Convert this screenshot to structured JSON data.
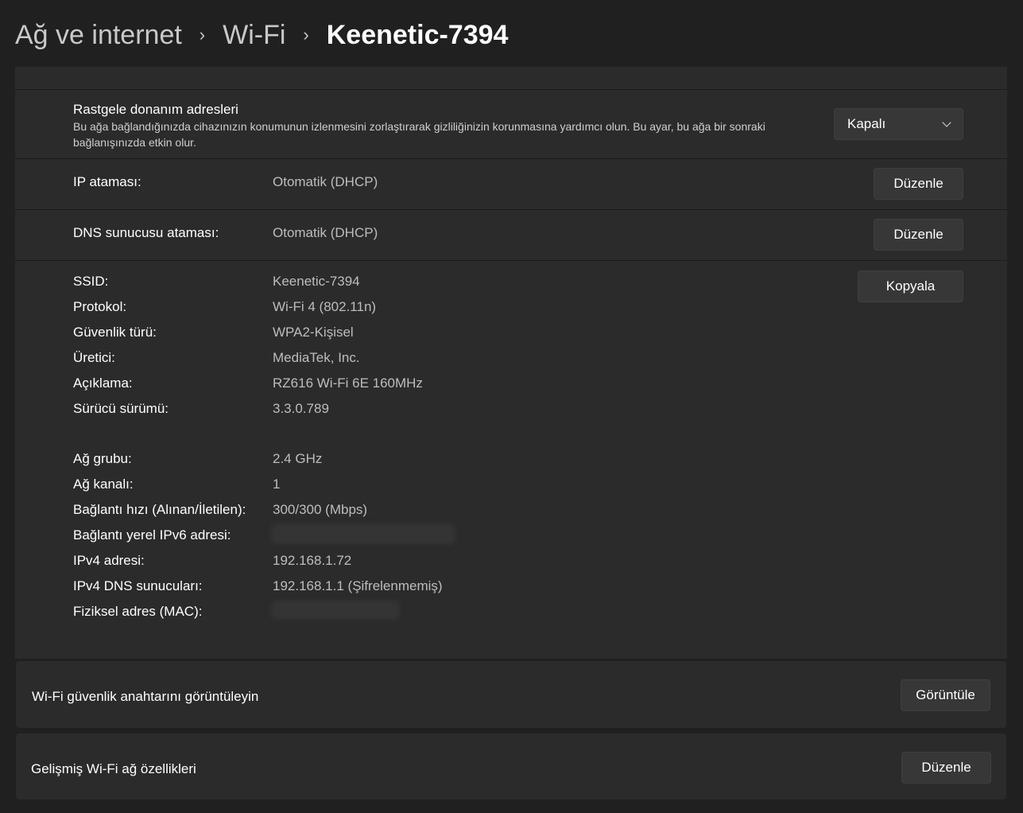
{
  "breadcrumb": {
    "item1": "Ağ ve internet",
    "item2": "Wi-Fi",
    "current": "Keenetic-7394",
    "separator": "›"
  },
  "random_hw": {
    "title": "Rastgele donanım adresleri",
    "description": "Bu ağa bağlandığınızda cihazınızın konumunun izlenmesini zorlaştırarak gizliliğinizin korunmasına yardımcı olun. Bu ayar, bu ağa bir sonraki bağlanışınızda etkin olur.",
    "select_value": "Kapalı"
  },
  "ip_assignment": {
    "label": "IP ataması:",
    "value": "Otomatik (DHCP)",
    "button": "Düzenle"
  },
  "dns_assignment": {
    "label": "DNS sunucusu ataması:",
    "value": "Otomatik (DHCP)",
    "button": "Düzenle"
  },
  "properties": {
    "copy_button": "Kopyala",
    "items": [
      {
        "label": "SSID:",
        "value": "Keenetic-7394"
      },
      {
        "label": "Protokol:",
        "value": "Wi-Fi 4 (802.11n)"
      },
      {
        "label": "Güvenlik türü:",
        "value": "WPA2-Kişisel"
      },
      {
        "label": "Üretici:",
        "value": "MediaTek, Inc."
      },
      {
        "label": "Açıklama:",
        "value": "RZ616 Wi-Fi 6E 160MHz"
      },
      {
        "label": "Sürücü sürümü:",
        "value": "3.3.0.789"
      },
      {
        "label": "Ağ grubu:",
        "value": "2.4 GHz"
      },
      {
        "label": "Ağ kanalı:",
        "value": "1"
      },
      {
        "label": "Bağlantı hızı (Alınan/İletilen):",
        "value": "300/300 (Mbps)"
      },
      {
        "label": "Bağlantı yerel IPv6 adresi:",
        "value": ""
      },
      {
        "label": "IPv4 adresi:",
        "value": "192.168.1.72"
      },
      {
        "label": "IPv4 DNS sunucuları:",
        "value": "192.168.1.1 (Şifrelenmemiş)"
      },
      {
        "label": "Fiziksel adres (MAC):",
        "value": ""
      }
    ]
  },
  "security_key": {
    "label": "Wi-Fi güvenlik anahtarını görüntüleyin",
    "button": "Görüntüle"
  },
  "advanced": {
    "label": "Gelişmiş Wi-Fi ağ özellikleri",
    "button": "Düzenle"
  }
}
